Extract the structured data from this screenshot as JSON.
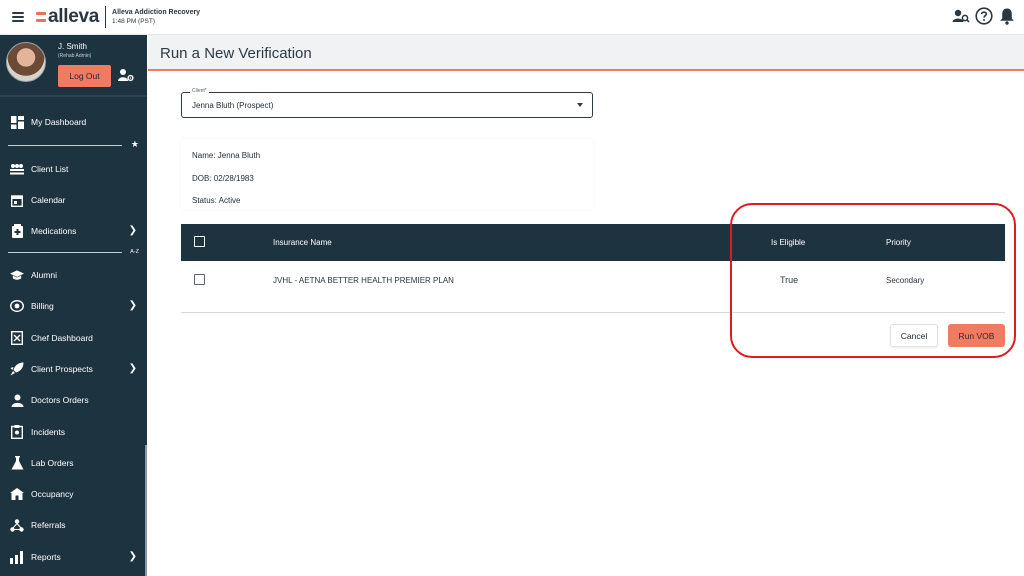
{
  "topbar": {
    "logo_text": "alleva",
    "org_name": "Alleva Addiction Recovery",
    "org_time": "1:48 PM (PST)",
    "icons": [
      "menu-icon",
      "user-search-icon",
      "help-icon",
      "bell-icon"
    ]
  },
  "profile": {
    "name": "J. Smith",
    "role": "(Rehab Admin)",
    "logout_label": "Log Out"
  },
  "sidebar": {
    "favorites_marker": "★",
    "az_marker": "A-Z",
    "items": [
      {
        "label": "My Dashboard",
        "icon": "dashboard-icon",
        "chevron": false
      },
      {
        "label": "Client List",
        "icon": "client-list-icon",
        "chevron": false
      },
      {
        "label": "Calendar",
        "icon": "calendar-icon",
        "chevron": false
      },
      {
        "label": "Medications",
        "icon": "medications-icon",
        "chevron": true
      },
      {
        "label": "Alumni",
        "icon": "graduation-cap-icon",
        "chevron": false
      },
      {
        "label": "Billing",
        "icon": "billing-icon",
        "chevron": true
      },
      {
        "label": "Chef Dashboard",
        "icon": "chef-icon",
        "chevron": false
      },
      {
        "label": "Client Prospects",
        "icon": "rocket-icon",
        "chevron": true
      },
      {
        "label": "Doctors Orders",
        "icon": "doctor-icon",
        "chevron": false
      },
      {
        "label": "Incidents",
        "icon": "incidents-icon",
        "chevron": false
      },
      {
        "label": "Lab Orders",
        "icon": "flask-icon",
        "chevron": false
      },
      {
        "label": "Occupancy",
        "icon": "house-icon",
        "chevron": false
      },
      {
        "label": "Referrals",
        "icon": "referrals-icon",
        "chevron": false
      },
      {
        "label": "Reports",
        "icon": "reports-icon",
        "chevron": true
      }
    ]
  },
  "page": {
    "title": "Run a New Verification"
  },
  "client_select": {
    "legend": "Client*",
    "value": "Jenna Bluth (Prospect)"
  },
  "client_info": {
    "name": "Name: Jenna Bluth",
    "dob": "DOB: 02/28/1983",
    "status": "Status: Active"
  },
  "insurance_table": {
    "columns": [
      "Insurance Name",
      "Is Eligible",
      "Priority"
    ],
    "rows": [
      {
        "name": "JVHL - AETNA BETTER HEALTH PREMIER PLAN",
        "eligible": "True",
        "priority": "Secondary"
      }
    ]
  },
  "actions": {
    "cancel_label": "Cancel",
    "run_label": "Run VOB"
  },
  "colors": {
    "accent": "#f07b62",
    "sidebar_bg": "#1e3340",
    "table_header_bg": "#1e3340",
    "annotation_red": "#e01a22"
  }
}
